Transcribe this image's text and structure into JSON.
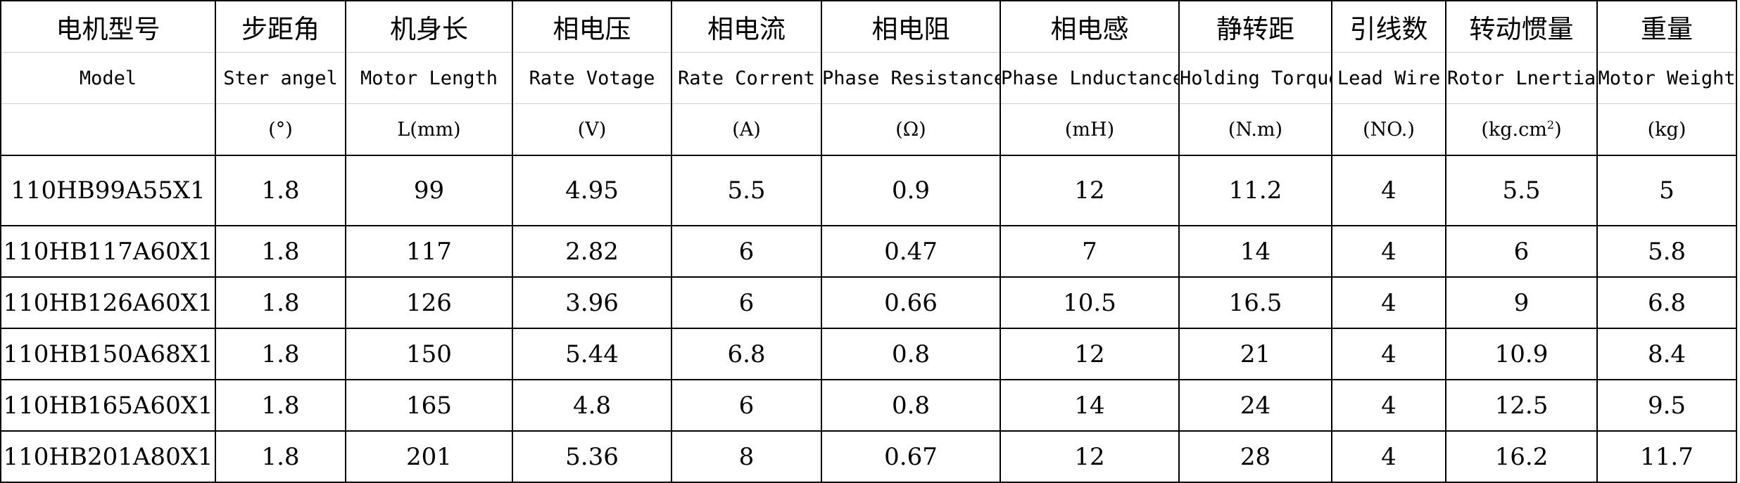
{
  "columns": [
    {
      "zh": "电机型号",
      "en": "Model",
      "unit": ""
    },
    {
      "zh": "步距角",
      "en": "Ster angel",
      "unit": "(°)"
    },
    {
      "zh": "机身长",
      "en": "Motor Length",
      "unit": "L(mm)"
    },
    {
      "zh": "相电压",
      "en": "Rate Votage",
      "unit": "(V)"
    },
    {
      "zh": "相电流",
      "en": "Rate Corrent",
      "unit": "(A)"
    },
    {
      "zh": "相电阻",
      "en": "Phase Resistance",
      "unit": "(Ω)"
    },
    {
      "zh": "相电感",
      "en": "Phase Lnductance",
      "unit": "(mH)"
    },
    {
      "zh": "静转距",
      "en": "Holding Torque",
      "unit": "(N.m)"
    },
    {
      "zh": "引线数",
      "en": "Lead Wire",
      "unit": "(NO.)"
    },
    {
      "zh": "转动惯量",
      "en": "Rotor Lnertia",
      "unit": "(kg.cm",
      "unit_sup": "2",
      "unit_tail": ")"
    },
    {
      "zh": "重量",
      "en": "Motor Weight",
      "unit": "(kg)"
    }
  ],
  "rows": [
    [
      "110HB99A55X1",
      "1.8",
      "99",
      "4.95",
      "5.5",
      "0.9",
      "12",
      "11.2",
      "4",
      "5.5",
      "5"
    ],
    [
      "110HB117A60X1",
      "1.8",
      "117",
      "2.82",
      "6",
      "0.47",
      "7",
      "14",
      "4",
      "6",
      "5.8"
    ],
    [
      "110HB126A60X1",
      "1.8",
      "126",
      "3.96",
      "6",
      "0.66",
      "10.5",
      "16.5",
      "4",
      "9",
      "6.8"
    ],
    [
      "110HB150A68X1",
      "1.8",
      "150",
      "5.44",
      "6.8",
      "0.8",
      "12",
      "21",
      "4",
      "10.9",
      "8.4"
    ],
    [
      "110HB165A60X1",
      "1.8",
      "165",
      "4.8",
      "6",
      "0.8",
      "14",
      "24",
      "4",
      "12.5",
      "9.5"
    ],
    [
      "110HB201A80X1",
      "1.8",
      "201",
      "5.36",
      "8",
      "0.67",
      "12",
      "28",
      "4",
      "16.2",
      "11.7"
    ]
  ]
}
